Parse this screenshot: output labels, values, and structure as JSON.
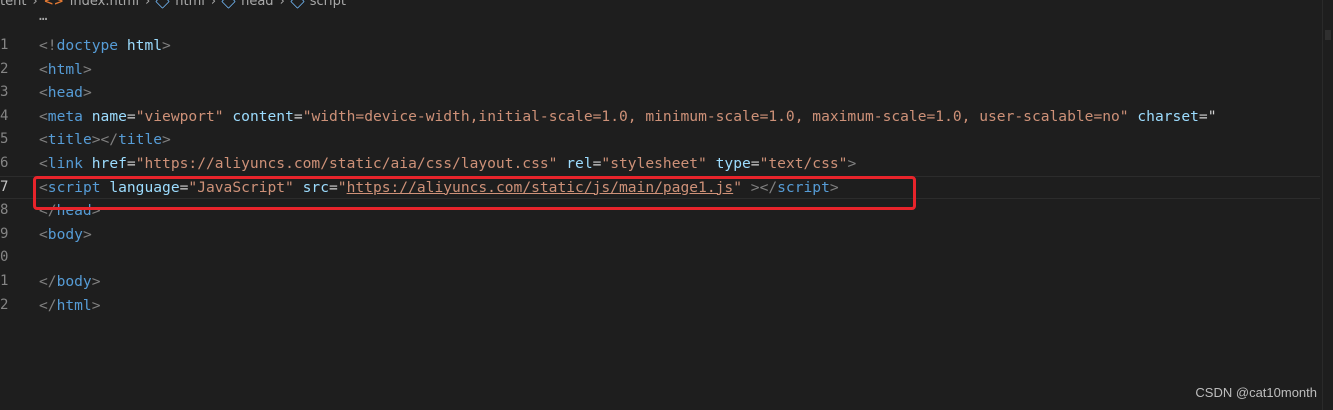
{
  "breadcrumb": {
    "items": [
      {
        "label": "tent",
        "icon": "none"
      },
      {
        "label": "index.html",
        "icon": "html-file-icon"
      },
      {
        "label": "html",
        "icon": "symbol-cube-icon"
      },
      {
        "label": "head",
        "icon": "symbol-cube-icon"
      },
      {
        "label": "script",
        "icon": "symbol-cube-icon"
      }
    ]
  },
  "overflow": "…",
  "lines": [
    {
      "num": "1",
      "tokens": [
        [
          "t",
          "<!"
        ],
        [
          "n",
          "doctype"
        ],
        [
          "p",
          " "
        ],
        [
          "a",
          "html"
        ],
        [
          "t",
          ">"
        ]
      ]
    },
    {
      "num": "2",
      "tokens": [
        [
          "t",
          "<"
        ],
        [
          "n",
          "html"
        ],
        [
          "t",
          ">"
        ]
      ]
    },
    {
      "num": "3",
      "tokens": [
        [
          "t",
          "<"
        ],
        [
          "n",
          "head"
        ],
        [
          "t",
          ">"
        ]
      ]
    },
    {
      "num": "4",
      "tokens": [
        [
          "t",
          "<"
        ],
        [
          "n",
          "meta"
        ],
        [
          "p",
          " "
        ],
        [
          "a",
          "name"
        ],
        [
          "p",
          "="
        ],
        [
          "s",
          "\"viewport\""
        ],
        [
          "p",
          " "
        ],
        [
          "a",
          "content"
        ],
        [
          "p",
          "="
        ],
        [
          "s",
          "\"width=device-width,initial-scale=1.0, minimum-scale=1.0, maximum-scale=1.0, user-scalable=no\""
        ],
        [
          "p",
          " "
        ],
        [
          "a",
          "charset"
        ],
        [
          "p",
          "=\""
        ]
      ]
    },
    {
      "num": "5",
      "tokens": [
        [
          "t",
          "<"
        ],
        [
          "n",
          "title"
        ],
        [
          "t",
          "></"
        ],
        [
          "n",
          "title"
        ],
        [
          "t",
          ">"
        ]
      ]
    },
    {
      "num": "6",
      "tokens": [
        [
          "t",
          "<"
        ],
        [
          "n",
          "link"
        ],
        [
          "p",
          " "
        ],
        [
          "a",
          "href"
        ],
        [
          "p",
          "="
        ],
        [
          "s",
          "\"https://aliyuncs.com/static/aia/css/layout.css\""
        ],
        [
          "p",
          " "
        ],
        [
          "a",
          "rel"
        ],
        [
          "p",
          "="
        ],
        [
          "s",
          "\"stylesheet\""
        ],
        [
          "p",
          " "
        ],
        [
          "a",
          "type"
        ],
        [
          "p",
          "="
        ],
        [
          "s",
          "\"text/css\""
        ],
        [
          "t",
          ">"
        ]
      ]
    },
    {
      "num": "7",
      "active": true,
      "tokens": [
        [
          "t",
          "<"
        ],
        [
          "n",
          "script"
        ],
        [
          "p",
          " "
        ],
        [
          "a",
          "language"
        ],
        [
          "p",
          "="
        ],
        [
          "s",
          "\"JavaScript\""
        ],
        [
          "p",
          " "
        ],
        [
          "a",
          "src"
        ],
        [
          "p",
          "="
        ],
        [
          "s",
          "\""
        ],
        [
          "su",
          "https://aliyuncs.com/static/js/main/page1.js"
        ],
        [
          "s",
          "\""
        ],
        [
          "p",
          " "
        ],
        [
          "t",
          "></"
        ],
        [
          "n",
          "script"
        ],
        [
          "t",
          ">"
        ]
      ]
    },
    {
      "num": "8",
      "tokens": [
        [
          "t",
          "</"
        ],
        [
          "n",
          "head"
        ],
        [
          "t",
          ">"
        ]
      ]
    },
    {
      "num": "9",
      "tokens": [
        [
          "t",
          "<"
        ],
        [
          "n",
          "body"
        ],
        [
          "t",
          ">"
        ]
      ]
    },
    {
      "num": "0",
      "tokens": []
    },
    {
      "num": "1",
      "tokens": [
        [
          "t",
          "</"
        ],
        [
          "n",
          "body"
        ],
        [
          "t",
          ">"
        ]
      ]
    },
    {
      "num": "2",
      "tokens": [
        [
          "t",
          "</"
        ],
        [
          "n",
          "html"
        ],
        [
          "t",
          ">"
        ]
      ]
    }
  ],
  "highlight_color": "#e8242b",
  "watermark": "CSDN @cat10month"
}
